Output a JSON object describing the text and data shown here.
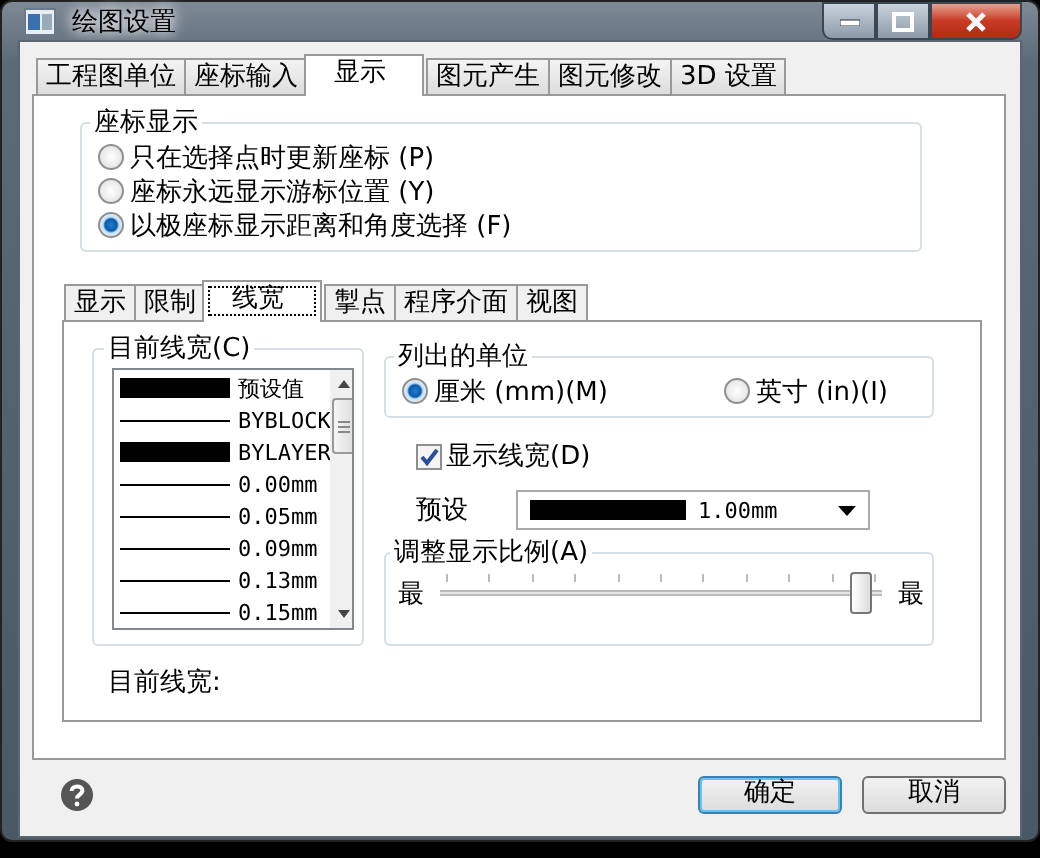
{
  "window": {
    "title": "绘图设置"
  },
  "tabs": [
    {
      "label": "工程图单位",
      "selected": false
    },
    {
      "label": "座标输入",
      "selected": false
    },
    {
      "label": "显示",
      "selected": true
    },
    {
      "label": "图元产生",
      "selected": false
    },
    {
      "label": "图元修改",
      "selected": false
    },
    {
      "label": "3D 设置",
      "selected": false
    }
  ],
  "coordinate_display": {
    "title": "座标显示",
    "options": [
      {
        "label": "只在选择点时更新座标 (P)",
        "selected": false
      },
      {
        "label": "座标永远显示游标位置 (Y)",
        "selected": false
      },
      {
        "label": "以极座标显示距离和角度选择 (F)",
        "selected": true
      }
    ]
  },
  "inner_tabs": [
    {
      "label": "显示",
      "selected": false
    },
    {
      "label": "限制",
      "selected": false
    },
    {
      "label": "线宽",
      "selected": true
    },
    {
      "label": "掣点",
      "selected": false
    },
    {
      "label": "程序介面",
      "selected": false
    },
    {
      "label": "视图",
      "selected": false
    }
  ],
  "lineweights": {
    "title": "目前线宽(C)",
    "items": [
      {
        "label": "预设值",
        "kind": "thick"
      },
      {
        "label": "BYBLOCK",
        "kind": "thin"
      },
      {
        "label": "BYLAYER",
        "kind": "thick"
      },
      {
        "label": "0.00mm",
        "kind": "thin"
      },
      {
        "label": "0.05mm",
        "kind": "thin"
      },
      {
        "label": "0.09mm",
        "kind": "thin"
      },
      {
        "label": "0.13mm",
        "kind": "thin"
      },
      {
        "label": "0.15mm",
        "kind": "thin"
      }
    ]
  },
  "current_lineweight": "目前线宽:",
  "units": {
    "title": "列出的单位",
    "options": [
      {
        "label": "厘米 (mm)(M)",
        "selected": true
      },
      {
        "label": "英寸 (in)(I)",
        "selected": false
      }
    ]
  },
  "show_lineweight": {
    "label": "显示线宽(D)",
    "checked": true
  },
  "default_weight": {
    "label": "预设",
    "value": "1.00mm"
  },
  "scale": {
    "title": "调整显示比例(A)",
    "min_label": "最",
    "max_label": "最",
    "level": 0.95
  },
  "buttons": [
    {
      "label": "确定",
      "kind": "default"
    },
    {
      "label": "取消",
      "kind": "normal"
    }
  ]
}
